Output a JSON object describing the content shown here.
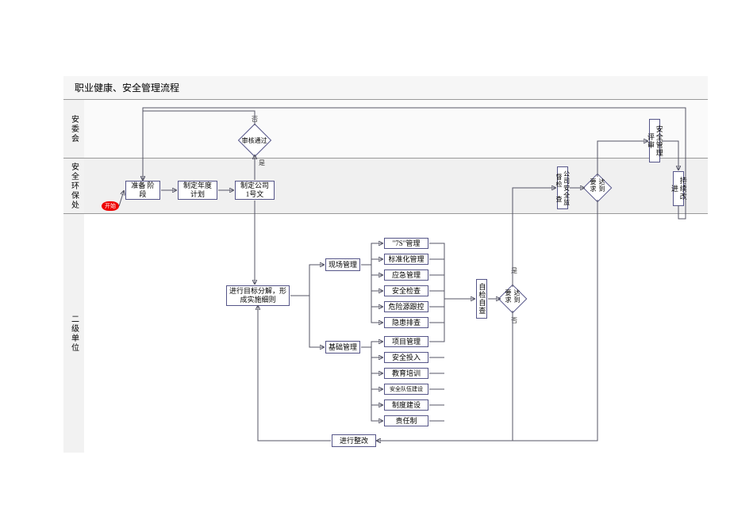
{
  "title": "职业健康、安全管理流程",
  "lanes": {
    "l1": "安委会",
    "l2": "安全环保处",
    "l3": "二级单位"
  },
  "nodes": {
    "start": "开始",
    "prepare": "准备\n阶段",
    "annual_plan": "制定年度\n计划",
    "company_doc": "制定公司\n1号文",
    "approve": "审核通过",
    "decompose": "进行目标分解，形\n成实施细则",
    "site_mgmt": "现场管理",
    "base_mgmt": "基础管理",
    "s7s": "\"7S\"管理",
    "std": "标准化管理",
    "emerg": "应急管理",
    "inspect": "安全检查",
    "hazard": "危险源跟控",
    "hidden": "隐患排查",
    "proj": "项目管理",
    "invest": "安全投入",
    "edu": "教育培训",
    "team": "安全队伍建设",
    "system": "制度建设",
    "resp": "责任制",
    "self_check": "自检自查",
    "req1": "达到要求",
    "rectify": "进行整改",
    "supervise": "公司安全监督检\n查",
    "req2": "达到要求",
    "assess": "安全管理评审",
    "improve": "持续改进",
    "yes": "是",
    "no": "否"
  }
}
